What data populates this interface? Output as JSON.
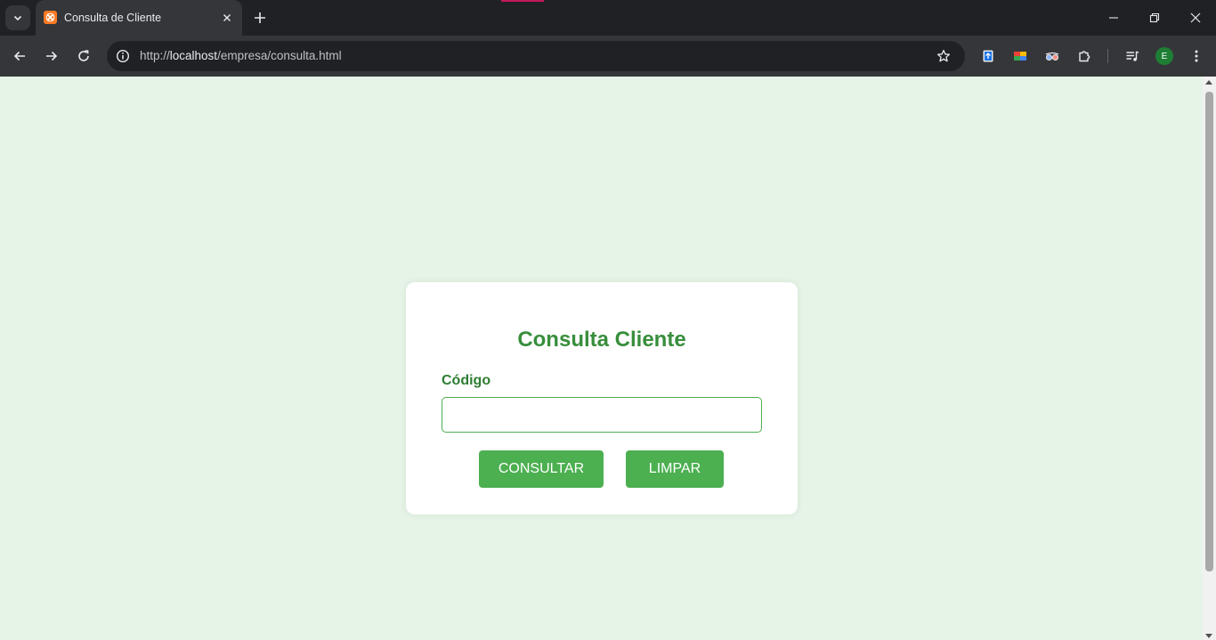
{
  "browser": {
    "tab": {
      "title": "Consulta de Cliente"
    },
    "address": {
      "scheme": "http://",
      "host": "localhost",
      "path": "/empresa/consulta.html"
    },
    "profile_initial": "E"
  },
  "form": {
    "title": "Consulta Cliente",
    "code_label": "Código",
    "code_value": "",
    "submit_label": "CONSULTAR",
    "clear_label": "LIMPAR"
  },
  "colors": {
    "page_background": "#e6f4e7",
    "accent": "#4caf50",
    "title": "#388e3c"
  }
}
